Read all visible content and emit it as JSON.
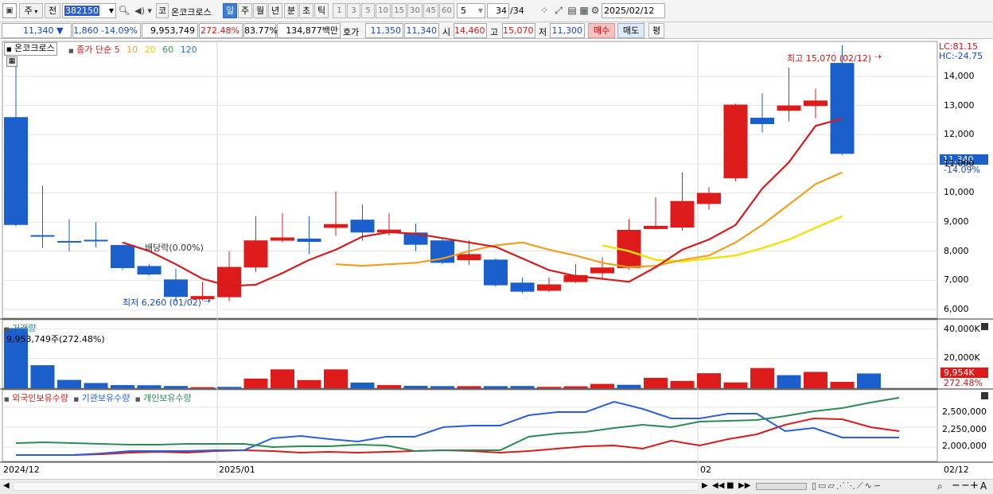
{
  "toolbar": {
    "market_label": "주",
    "prev_label": "전",
    "code_value": "382150",
    "speaker_icon": "speaker-icon",
    "market_badge": "코",
    "stock_name": "온코크로스",
    "periods": [
      "일",
      "주",
      "월",
      "년",
      "분",
      "초",
      "틱"
    ],
    "selected_period": "일",
    "intervals": [
      "1",
      "3",
      "5",
      "10",
      "15",
      "30",
      "45",
      "60"
    ],
    "count_value": "5",
    "page_indicator": "34",
    "page_total": "/34",
    "date_value": "2025/02/12"
  },
  "quote": {
    "price": "11,340",
    "direction": "▼",
    "change": "1,860",
    "change_pct": "-14.09%",
    "volume": "9,953,749",
    "volume_ratio": "272.48%",
    "turnover": "83.77%",
    "amount": "134,877백만",
    "bid_label": "호가",
    "bid_sell": "11,350",
    "bid_buy": "11,340",
    "open_label": "시",
    "open": "14,460",
    "high_label": "고",
    "high": "15,070",
    "low_label": "저",
    "low": "11,300",
    "buy_button": "매수",
    "sell_button": "매도",
    "avg_button": "평"
  },
  "price_panel": {
    "stock_tab": "온코크로스",
    "legend_title": "종가 단순",
    "ma_labels": [
      "5",
      "10",
      "20",
      "60",
      "120"
    ],
    "ma_colors": [
      "#d41c1c",
      "#f0a020",
      "#f2e010",
      "#3a9a50",
      "#2b6fcf"
    ],
    "lc_label": "LC:81.15",
    "hc_label": "HC:-24.75",
    "last_price_tag": "11,340",
    "last_pct_tag": "-14.09%",
    "high_annotation": "최고 15,070 (02/12)",
    "low_annotation": "최저 6,260 (01/02)",
    "dividend_annotation": "배당락(0.00%)",
    "y_ticks": [
      "14,000",
      "13,000",
      "12,000",
      "11,000",
      "10,000",
      "9,000",
      "8,000",
      "7,000",
      "6,000"
    ]
  },
  "volume_panel": {
    "title": "거래량",
    "info": "9,953,749주(272.48%)",
    "y_ticks": [
      "40,000K",
      "20,000K"
    ],
    "last_tag": "9,954K",
    "last_pct_tag": "272.48%"
  },
  "holdings_panel": {
    "series_labels": [
      "외국인보유수량",
      "기관보유수량",
      "개인보유수량"
    ],
    "series_colors": [
      "#d41c1c",
      "#2b5fd8",
      "#2e8a55"
    ],
    "y_ticks": [
      "2,500,000",
      "2,250,000",
      "2,000,000"
    ]
  },
  "x_axis": {
    "labels": [
      "2024/12",
      "2025/01",
      "02",
      "02/12"
    ]
  },
  "colors": {
    "up": "#dd1b1b",
    "down": "#1a5fcc",
    "grid": "#e4e4e4"
  },
  "chart_data": [
    {
      "type": "candlestick",
      "title": "",
      "categories": [
        "c01",
        "c02",
        "c03",
        "c04",
        "c05",
        "c06",
        "c07",
        "c08",
        "c09",
        "c10",
        "c11",
        "c12",
        "c13",
        "c14",
        "c15",
        "c16",
        "c17",
        "c18",
        "c19",
        "c20",
        "c21",
        "c22",
        "c23",
        "c24",
        "c25",
        "c26",
        "c27",
        "c28",
        "c29",
        "c30",
        "c31",
        "c32",
        "c33",
        "c34"
      ],
      "open": [
        12600,
        8550,
        8350,
        8390,
        8210,
        7490,
        7030,
        6350,
        6420,
        7440,
        8360,
        8430,
        8800,
        9080,
        8640,
        8640,
        8370,
        7690,
        7710,
        6920,
        6640,
        6940,
        7240,
        7420,
        8760,
        8810,
        9620,
        10500,
        12580,
        12820,
        12980,
        14460
      ],
      "close": [
        8900,
        8520,
        8300,
        8340,
        7420,
        7200,
        6430,
        6460,
        7460,
        8370,
        8470,
        8320,
        8930,
        8640,
        8740,
        8220,
        7600,
        7900,
        6830,
        6610,
        6860,
        7180,
        7440,
        8730,
        8870,
        9720,
        10000,
        13030,
        12360,
        13000,
        13170,
        11340
      ],
      "high": [
        14500,
        10250,
        9100,
        9000,
        8220,
        7550,
        7400,
        6950,
        8000,
        9200,
        9300,
        9200,
        10050,
        9600,
        9300,
        8950,
        8450,
        8380,
        7750,
        7100,
        7100,
        7550,
        7800,
        9100,
        9850,
        10700,
        10200,
        13060,
        13420,
        14300,
        13580,
        15070
      ],
      "low": [
        8850,
        8100,
        7990,
        8130,
        7350,
        7170,
        6260,
        6300,
        6280,
        7290,
        8300,
        7900,
        8530,
        8360,
        8540,
        8000,
        7550,
        7520,
        6780,
        6550,
        6600,
        6920,
        7040,
        7380,
        8750,
        8700,
        9420,
        10400,
        12070,
        12450,
        12560,
        11300
      ],
      "ma5": [
        null,
        null,
        null,
        null,
        8300,
        8000,
        7550,
        7050,
        6800,
        6850,
        7250,
        7700,
        8050,
        8500,
        8650,
        8600,
        8450,
        8300,
        8150,
        7750,
        7350,
        7150,
        7050,
        6950,
        7450,
        8050,
        8400,
        8900,
        10150,
        11050,
        12300,
        12550
      ],
      "ma10": [
        null,
        null,
        null,
        null,
        null,
        null,
        null,
        null,
        null,
        7550,
        7500,
        7550,
        7600,
        7750,
        8000,
        8200,
        8300,
        8050,
        7850,
        7600,
        7450,
        7500,
        7700,
        7850,
        8300,
        8900,
        9600,
        10300,
        10700
      ],
      "ma20": [
        null,
        null,
        null,
        null,
        null,
        null,
        null,
        null,
        null,
        null,
        null,
        null,
        null,
        null,
        null,
        null,
        null,
        null,
        8200,
        8000,
        7700,
        7650,
        7750,
        7850,
        8100,
        8400,
        8800,
        9200
      ]
    },
    {
      "type": "bar",
      "title": "거래량",
      "unit": "K",
      "values": [
        40500,
        15500,
        5600,
        3500,
        2100,
        2000,
        1500,
        700,
        900,
        6500,
        12700,
        5500,
        12700,
        3800,
        2100,
        1600,
        1400,
        1400,
        1400,
        1500,
        900,
        1300,
        2900,
        2300,
        7000,
        4900,
        10100,
        3900,
        13600,
        8800,
        11000,
        4300,
        9954
      ],
      "up_down": [
        "down",
        "down",
        "down",
        "down",
        "down",
        "down",
        "down",
        "up",
        "down",
        "up",
        "up",
        "up",
        "up",
        "down",
        "up",
        "down",
        "down",
        "up",
        "down",
        "down",
        "up",
        "up",
        "up",
        "down",
        "up",
        "up",
        "up",
        "up",
        "up",
        "down",
        "up",
        "up",
        "down"
      ]
    },
    {
      "type": "line",
      "title": "",
      "series": [
        {
          "name": "외국인보유수량",
          "values": [
            1900000,
            1900000,
            1900000,
            1910000,
            1930000,
            1940000,
            1930000,
            1950000,
            1960000,
            1950000,
            1930000,
            1940000,
            1930000,
            1940000,
            1950000,
            1960000,
            1950000,
            1930000,
            1950000,
            1980000,
            2010000,
            2020000,
            1980000,
            2080000,
            2020000,
            2100000,
            2160000,
            2280000,
            2360000,
            2350000,
            2250000,
            2200000
          ]
        },
        {
          "name": "기관보유수량",
          "values": [
            1900000,
            1900000,
            1900000,
            1920000,
            1950000,
            1950000,
            1950000,
            1960000,
            1960000,
            2110000,
            2140000,
            2100000,
            2070000,
            2130000,
            2130000,
            2250000,
            2270000,
            2270000,
            2400000,
            2440000,
            2440000,
            2570000,
            2480000,
            2360000,
            2360000,
            2420000,
            2420000,
            2200000,
            2240000,
            2120000,
            2120000,
            2120000
          ]
        },
        {
          "name": "개인보유수량",
          "values": [
            2050000,
            2060000,
            2050000,
            2040000,
            2030000,
            2030000,
            2040000,
            2040000,
            2040000,
            2000000,
            2010000,
            2010000,
            2030000,
            2020000,
            1950000,
            1960000,
            1960000,
            1960000,
            2130000,
            2170000,
            2190000,
            2240000,
            2280000,
            2250000,
            2320000,
            2330000,
            2340000,
            2390000,
            2450000,
            2490000,
            2560000,
            2620000
          ]
        }
      ]
    }
  ]
}
